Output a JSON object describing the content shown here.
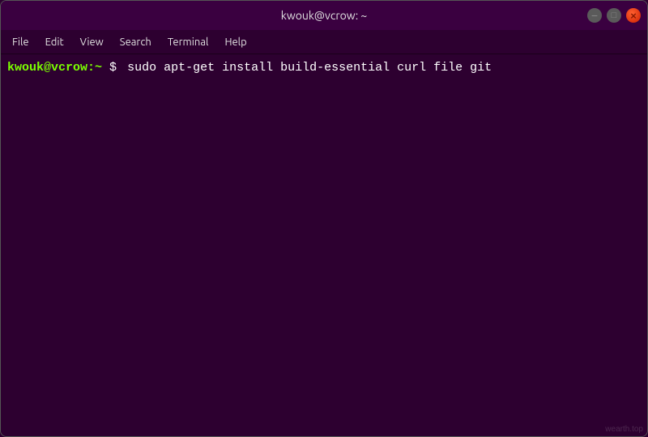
{
  "window": {
    "title": "kwouk@vcrow: ~",
    "controls": {
      "minimize_label": "−",
      "maximize_label": "□",
      "close_label": "×"
    }
  },
  "menu": {
    "items": [
      {
        "label": "File"
      },
      {
        "label": "Edit"
      },
      {
        "label": "View"
      },
      {
        "label": "Search"
      },
      {
        "label": "Terminal"
      },
      {
        "label": "Help"
      }
    ]
  },
  "terminal": {
    "prompt_user": "kwouk@vcrow:",
    "prompt_path": "~",
    "prompt_symbol": "$",
    "command": "sudo apt-get install build-essential curl file git"
  },
  "watermark": {
    "text": "wearth.top"
  }
}
